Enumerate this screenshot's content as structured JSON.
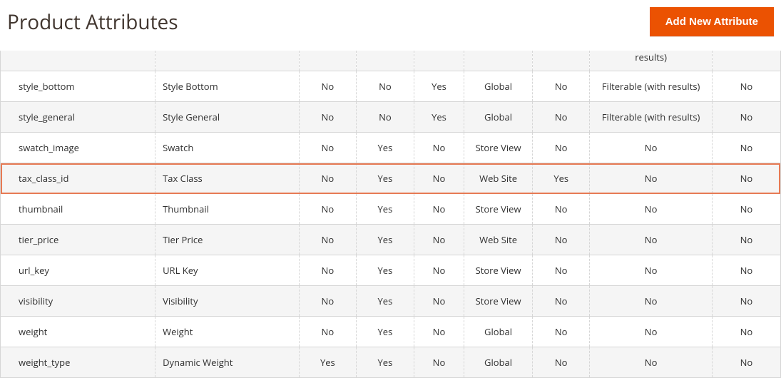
{
  "header": {
    "title": "Product Attributes",
    "add_button_label": "Add New Attribute"
  },
  "highlighted_row_index": 4,
  "rows": [
    {
      "attribute_code": "",
      "default_label": "",
      "required": "",
      "system": "",
      "visible": "",
      "scope": "",
      "searchable": "",
      "use_in_layered": "results)",
      "comparable": "",
      "cutoff": true
    },
    {
      "attribute_code": "style_bottom",
      "default_label": "Style Bottom",
      "required": "No",
      "system": "No",
      "visible": "Yes",
      "scope": "Global",
      "searchable": "No",
      "use_in_layered": "Filterable (with results)",
      "comparable": "No"
    },
    {
      "attribute_code": "style_general",
      "default_label": "Style General",
      "required": "No",
      "system": "No",
      "visible": "Yes",
      "scope": "Global",
      "searchable": "No",
      "use_in_layered": "Filterable (with results)",
      "comparable": "No"
    },
    {
      "attribute_code": "swatch_image",
      "default_label": "Swatch",
      "required": "No",
      "system": "Yes",
      "visible": "No",
      "scope": "Store View",
      "searchable": "No",
      "use_in_layered": "No",
      "comparable": "No"
    },
    {
      "attribute_code": "tax_class_id",
      "default_label": "Tax Class",
      "required": "No",
      "system": "Yes",
      "visible": "No",
      "scope": "Web Site",
      "searchable": "Yes",
      "use_in_layered": "No",
      "comparable": "No"
    },
    {
      "attribute_code": "thumbnail",
      "default_label": "Thumbnail",
      "required": "No",
      "system": "Yes",
      "visible": "No",
      "scope": "Store View",
      "searchable": "No",
      "use_in_layered": "No",
      "comparable": "No"
    },
    {
      "attribute_code": "tier_price",
      "default_label": "Tier Price",
      "required": "No",
      "system": "Yes",
      "visible": "No",
      "scope": "Web Site",
      "searchable": "No",
      "use_in_layered": "No",
      "comparable": "No"
    },
    {
      "attribute_code": "url_key",
      "default_label": "URL Key",
      "required": "No",
      "system": "Yes",
      "visible": "No",
      "scope": "Store View",
      "searchable": "No",
      "use_in_layered": "No",
      "comparable": "No"
    },
    {
      "attribute_code": "visibility",
      "default_label": "Visibility",
      "required": "No",
      "system": "Yes",
      "visible": "No",
      "scope": "Store View",
      "searchable": "No",
      "use_in_layered": "No",
      "comparable": "No"
    },
    {
      "attribute_code": "weight",
      "default_label": "Weight",
      "required": "No",
      "system": "Yes",
      "visible": "No",
      "scope": "Global",
      "searchable": "No",
      "use_in_layered": "No",
      "comparable": "No"
    },
    {
      "attribute_code": "weight_type",
      "default_label": "Dynamic Weight",
      "required": "Yes",
      "system": "Yes",
      "visible": "No",
      "scope": "Global",
      "searchable": "No",
      "use_in_layered": "No",
      "comparable": "No"
    }
  ]
}
